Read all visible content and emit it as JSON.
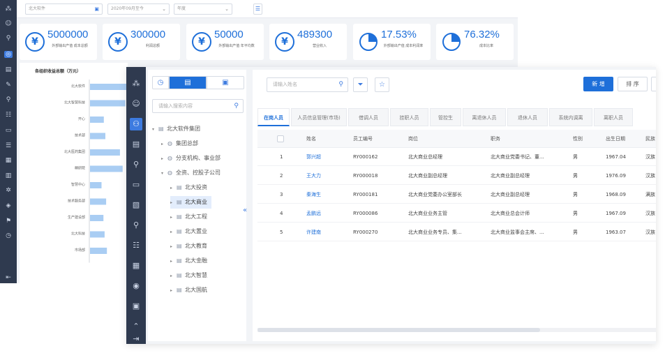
{
  "back": {
    "filters": {
      "org_placeholder": "北大软件",
      "date_value": "2020年09月至今",
      "type_value": "年度"
    },
    "kpis": [
      {
        "value": "5000000",
        "label": "外部输出产值 成本总额",
        "icon": "yen-lock-icon"
      },
      {
        "value": "300000",
        "label": "利润总额",
        "icon": "yen-lock-icon"
      },
      {
        "value": "50000",
        "label": "外部输出产值 年平均数",
        "icon": "yen-icon"
      },
      {
        "value": "489300",
        "label": "营业收入",
        "icon": "yen-icon"
      },
      {
        "value": "17.53%",
        "label": "外部输出产值 成本利润率",
        "icon": "pie-chart-icon"
      },
      {
        "value": "76.32%",
        "label": "成本比率",
        "icon": "pie-chart-icon"
      }
    ],
    "chart_title": "各组织收益总额（万元）"
  },
  "chart_data": {
    "type": "bar",
    "orientation": "horizontal",
    "title": "各组织收益总额（万元）",
    "categories": [
      "北大软件",
      "北大智慧科技",
      "开心",
      "技术部",
      "北大医药集团",
      "精研院",
      "智慧中心",
      "技术服务部",
      "生产建设部",
      "北大科技",
      "市场部"
    ],
    "values": [
      100,
      92,
      36,
      40,
      78,
      85,
      30,
      42,
      35,
      38,
      44
    ],
    "xlim": [
      0,
      100
    ]
  },
  "front": {
    "tree": {
      "search_placeholder": "请输入搜索内容",
      "nodes": [
        {
          "label": "北大软件集团",
          "level": 0,
          "expanded": true,
          "icon": "building-icon"
        },
        {
          "label": "集团总部",
          "level": 1,
          "expanded": false,
          "icon": "globe-icon"
        },
        {
          "label": "分支机构、事业部",
          "level": 1,
          "expanded": false,
          "icon": "globe-icon"
        },
        {
          "label": "全资、控股子公司",
          "level": 1,
          "expanded": true,
          "icon": "globe-icon"
        },
        {
          "label": "北大投资",
          "level": 2,
          "expanded": false,
          "icon": "building-icon"
        },
        {
          "label": "北大商业",
          "level": 2,
          "expanded": false,
          "icon": "building-icon",
          "selected": true
        },
        {
          "label": "北大工程",
          "level": 2,
          "expanded": false,
          "icon": "building-icon"
        },
        {
          "label": "北大置业",
          "level": 2,
          "expanded": false,
          "icon": "building-icon"
        },
        {
          "label": "北大教育",
          "level": 2,
          "expanded": false,
          "icon": "building-icon"
        },
        {
          "label": "北大金融",
          "level": 2,
          "expanded": false,
          "icon": "building-icon"
        },
        {
          "label": "北大智慧",
          "level": 2,
          "expanded": false,
          "icon": "building-icon"
        },
        {
          "label": "北大国航",
          "level": 2,
          "expanded": false,
          "icon": "building-icon"
        }
      ]
    },
    "toolbar": {
      "search_placeholder": "请输入姓名",
      "new_label": "新 增",
      "sort_label": "排 序"
    },
    "tabs": [
      "在岗人员",
      "人员信息管理(市场)",
      "借调人员",
      "挂职人员",
      "管控生",
      "离退休人员",
      "退休人员",
      "系统内调离",
      "离职人员"
    ],
    "table": {
      "headers": [
        "",
        "姓名",
        "员工编号",
        "岗位",
        "职务",
        "性别",
        "出生日期",
        "民族"
      ],
      "rows": [
        [
          "1",
          "郭兴超",
          "RY000162",
          "北大商业总经理",
          "北大商业党委书记、董...",
          "男",
          "1967.04",
          "汉族"
        ],
        [
          "2",
          "王大力",
          "RY000018",
          "北大商业副总经理",
          "北大商业副总经理",
          "男",
          "1976.09",
          "汉族"
        ],
        [
          "3",
          "秦海生",
          "RY000181",
          "北大商业党委办公室部长",
          "北大商业副总经理",
          "男",
          "1968.09",
          "满族"
        ],
        [
          "4",
          "孟鹏远",
          "RY000086",
          "北大商业业务主管",
          "北大商业总会计师",
          "男",
          "1967.09",
          "汉族"
        ],
        [
          "5",
          "许建南",
          "RY000270",
          "北大商业业务专员、集...",
          "北大商业监事会主席、...",
          "男",
          "1963.07",
          "汉族"
        ]
      ]
    }
  },
  "colors": {
    "accent": "#1e6fd9",
    "sidebar": "#2f3a4f",
    "bar": "#a9cdf3"
  }
}
